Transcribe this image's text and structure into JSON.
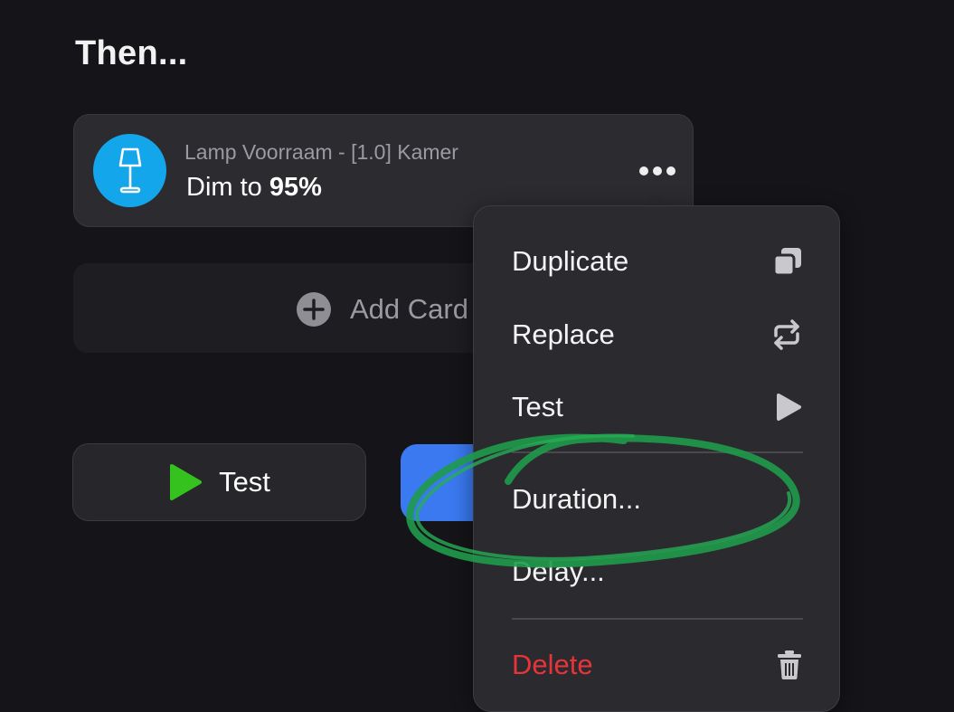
{
  "section": {
    "title": "Then..."
  },
  "card": {
    "subtitle": "Lamp Voorraam - [1.0] Kamer",
    "action_prefix": "Dim to ",
    "action_value": "95%",
    "icon": "floor-lamp-icon",
    "icon_color": "#14a6ea",
    "more_icon": "ellipsis-icon"
  },
  "add_card": {
    "label": "Add Card",
    "icon": "plus-circle-icon"
  },
  "buttons": {
    "test_label": "Test",
    "test_icon": "play-icon",
    "test_icon_color": "#36c21e",
    "save_color": "#3a79f0"
  },
  "menu": {
    "items": [
      {
        "label": "Duplicate",
        "icon": "duplicate-icon"
      },
      {
        "label": "Replace",
        "icon": "replace-arrows-icon"
      },
      {
        "label": "Test",
        "icon": "play-icon"
      },
      {
        "label": "Duration...",
        "icon": ""
      },
      {
        "label": "Delay...",
        "icon": ""
      },
      {
        "label": "Delete",
        "icon": "trash-icon",
        "color": "#e5343a"
      }
    ]
  },
  "annotation": {
    "type": "hand-drawn-ellipse",
    "color": "#1f9a4a"
  }
}
